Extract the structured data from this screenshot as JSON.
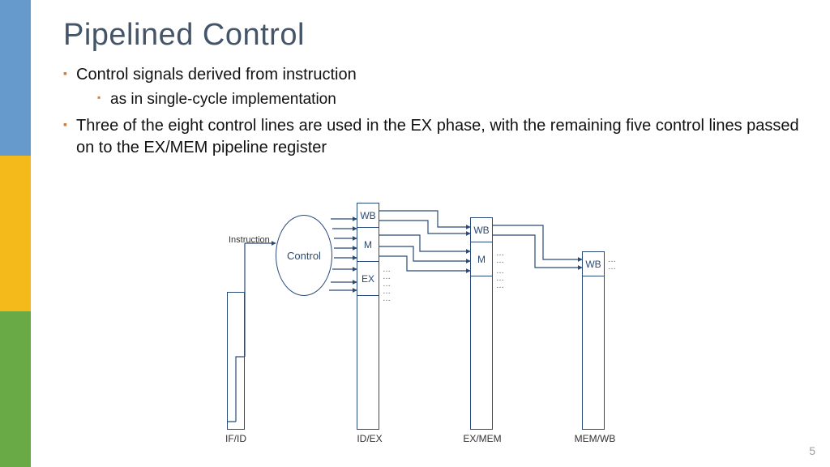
{
  "title": "Pipelined Control",
  "bullets": {
    "b1": "Control signals derived from instruction",
    "b1a": "as in single-cycle implementation",
    "b2": "Three of the eight control lines are used in the EX phase, with the remaining five control lines passed on to the EX/MEM pipeline register"
  },
  "diagram": {
    "instruction": "Instruction",
    "control": "Control",
    "cells": {
      "wb": "WB",
      "m": "M",
      "ex": "EX"
    },
    "labels": {
      "ifid": "IF/ID",
      "idex": "ID/EX",
      "exmem": "EX/MEM",
      "memwb": "MEM/WB"
    }
  },
  "slide_number": "5"
}
